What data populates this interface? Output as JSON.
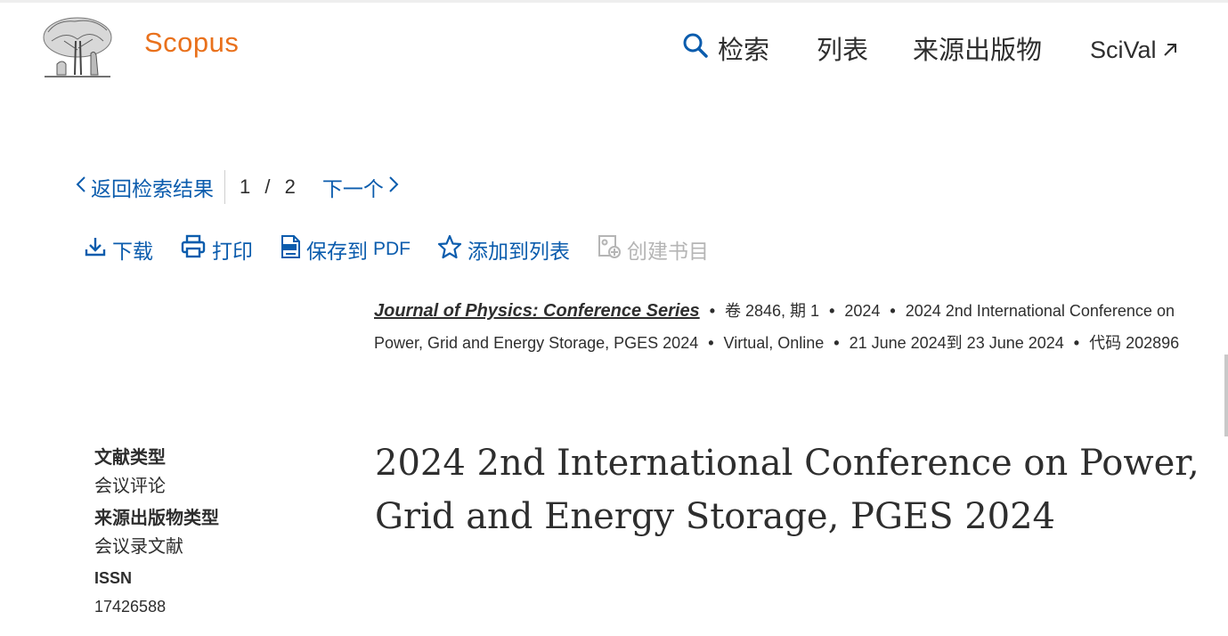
{
  "header": {
    "brand": "Scopus",
    "nav": {
      "search": "检索",
      "lists": "列表",
      "sources": "来源出版物",
      "scival": "SciVal"
    }
  },
  "results_nav": {
    "back": "返回检索结果",
    "current": "1",
    "separator": "/",
    "total": "2",
    "next": "下一个"
  },
  "toolbar": {
    "download": "下载",
    "print": "打印",
    "save_prefix": "保存到",
    "save_pdf": "PDF",
    "add_to_list": "添加到列表",
    "create_bib": "创建书目"
  },
  "meta": {
    "journal": "Journal of Physics: Conference Series",
    "volume_issue": "卷 2846, 期 1",
    "year": "2024",
    "conference": "2024 2nd International Conference on Power, Grid and Energy Storage, PGES 2024",
    "location": "Virtual, Online",
    "dates": "21 June 2024到 23 June 2024",
    "code": "代码 202896"
  },
  "document": {
    "type_label": "文献类型",
    "type_value": "会议评论",
    "source_type_label": "来源出版物类型",
    "source_type_value": "会议录文献",
    "issn_label": "ISSN",
    "issn_value": "17426588",
    "title": "2024 2nd International Conference on Power, Grid and Energy Storage, PGES 2024"
  },
  "colors": {
    "brand": "#e9711c",
    "link": "#0b5cad",
    "text": "#2e2e2e",
    "disabled": "#b5b5b5"
  },
  "icons": [
    "elsevier-tree-logo",
    "search-icon",
    "external-arrow-icon",
    "chevron-left-icon",
    "chevron-right-icon",
    "download-icon",
    "print-icon",
    "pdf-icon",
    "star-icon",
    "bibliography-icon"
  ]
}
